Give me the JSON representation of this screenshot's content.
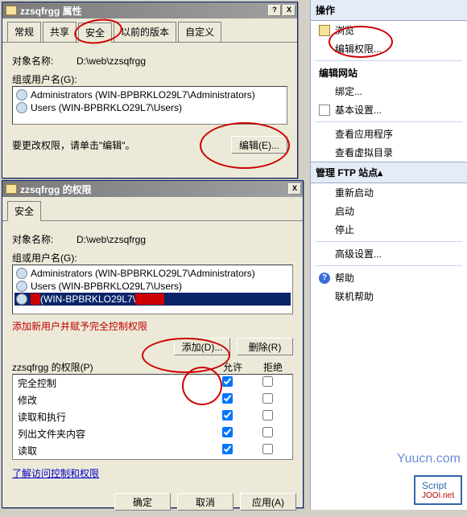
{
  "dialog1": {
    "title": "zzsqfrgg 属性",
    "tabs": [
      "常规",
      "共享",
      "安全",
      "以前的版本",
      "自定义"
    ],
    "active_tab": 2,
    "object_label": "对象名称:",
    "object_path": "D:\\web\\zzsqfrgg",
    "groups_label": "组或用户名(G):",
    "users": [
      "Administrators (WIN-BPBRKLO29L7\\Administrators)",
      "Users (WIN-BPBRKLO29L7\\Users)"
    ],
    "edit_hint": "要更改权限，请单击\"编辑\"。",
    "edit_btn": "编辑(E)..."
  },
  "dialog2": {
    "title": "zzsqfrgg 的权限",
    "tab": "安全",
    "object_label": "对象名称:",
    "object_path": "D:\\web\\zzsqfrgg",
    "groups_label": "组或用户名(G):",
    "users": [
      "Administrators (WIN-BPBRKLO29L7\\Administrators)",
      "Users (WIN-BPBRKLO29L7\\Users)",
      "(WIN-BPBRKLO29L7\\"
    ],
    "red_note": "添加新用户并赋予完全控制权限",
    "add_btn": "添加(D)...",
    "remove_btn": "删除(R)",
    "perm_label_prefix": "zzsqfrgg 的权限(P)",
    "col_allow": "允许",
    "col_deny": "拒绝",
    "perms": [
      {
        "name": "完全控制",
        "allow": true,
        "deny": false
      },
      {
        "name": "修改",
        "allow": true,
        "deny": false
      },
      {
        "name": "读取和执行",
        "allow": true,
        "deny": false
      },
      {
        "name": "列出文件夹内容",
        "allow": true,
        "deny": false
      },
      {
        "name": "读取",
        "allow": true,
        "deny": false
      }
    ],
    "learn_link": "了解访问控制和权限",
    "ok": "确定",
    "cancel": "取消",
    "apply": "应用(A)"
  },
  "right": {
    "header": "操作",
    "items1": [
      {
        "label": "浏览",
        "icon": "folder"
      },
      {
        "label": "编辑权限...",
        "icon": ""
      }
    ],
    "section1_label": "编辑网站",
    "items2": [
      {
        "label": "绑定...",
        "icon": ""
      },
      {
        "label": "基本设置...",
        "icon": "doc"
      }
    ],
    "items3": [
      {
        "label": "查看应用程序",
        "icon": ""
      },
      {
        "label": "查看虚拟目录",
        "icon": ""
      }
    ],
    "section2": "管理 FTP 站点",
    "items4": [
      {
        "label": "重新启动"
      },
      {
        "label": "启动"
      },
      {
        "label": "停止"
      }
    ],
    "adv": "高级设置...",
    "help": "帮助",
    "online_help": "联机帮助"
  },
  "watermark": "Yuucn.com",
  "script_badge": {
    "line1": "Script",
    "line2": "JOOI.net"
  }
}
